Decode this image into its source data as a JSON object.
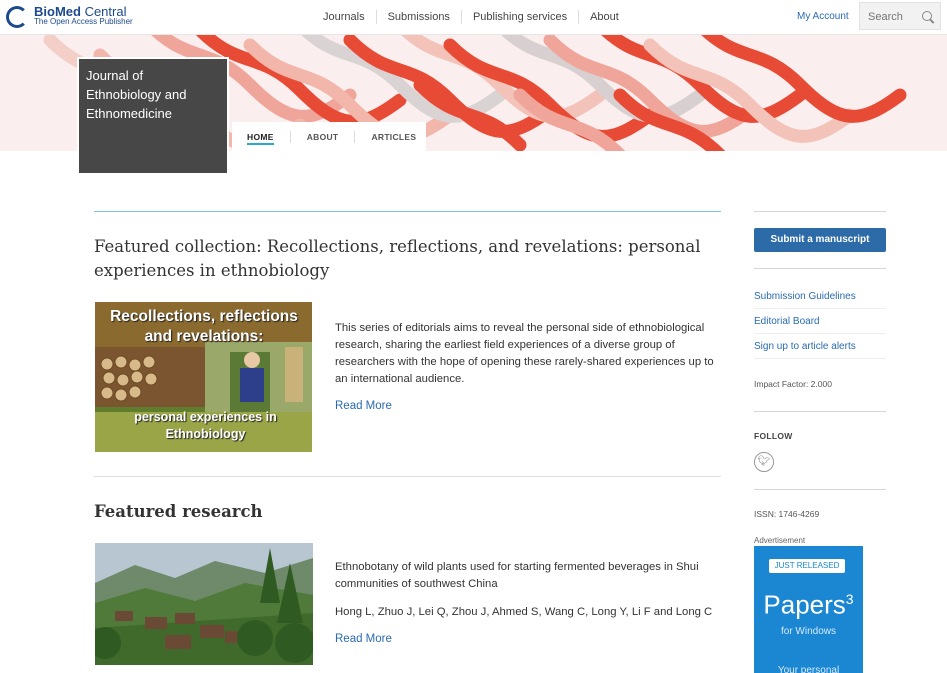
{
  "header": {
    "logo_main": "BioMed",
    "logo_main2": " Central",
    "logo_sub": "The Open Access Publisher",
    "nav": [
      "Journals",
      "Submissions",
      "Publishing services",
      "About"
    ],
    "my_account": "My Account",
    "search_placeholder": "Search"
  },
  "journal": {
    "title": "Journal of Ethnobiology and Ethnomedicine",
    "tabs": [
      "HOME",
      "ABOUT",
      "ARTICLES"
    ]
  },
  "featured_collection": {
    "heading": "Featured collection: Recollections, reflections, and revelations: personal experiences in ethnobiology",
    "image_title": "Recollections, reflections and revelations:",
    "image_subtitle": "personal experiences in Ethnobiology",
    "description": "This series of editorials aims to reveal the personal side of ethnobiological research, sharing the earliest field experiences of a diverse group of researchers with the hope of opening these rarely-shared experiences up to an international audience.",
    "read_more": "Read More"
  },
  "featured_research": {
    "heading": "Featured research",
    "article_title": "Ethnobotany of wild plants used for starting fermented beverages in Shui communities of southwest China",
    "authors": "Hong L, Zhuo J, Lei Q, Zhou J, Ahmed S, Wang C, Long Y, Li F and Long C",
    "read_more": "Read More"
  },
  "sidebar": {
    "submit_button": "Submit a manuscript",
    "links": [
      "Submission Guidelines",
      "Editorial Board",
      "Sign up to article alerts"
    ],
    "impact_factor": "Impact Factor: 2.000",
    "follow": "FOLLOW",
    "issn": "ISSN:  1746-4269",
    "ad_label": "Advertisement",
    "ad_badge": "JUST RELEASED",
    "ad_title": "Papers",
    "ad_sup": "3",
    "ad_sub": "for Windows",
    "ad_tail": "Your personal"
  },
  "colors": {
    "accent": "#2c6aa8",
    "link": "#2a6bb0",
    "teal_rule": "#7ac7d8",
    "journal_box": "#474747",
    "ad_bg": "#1b86d1"
  }
}
